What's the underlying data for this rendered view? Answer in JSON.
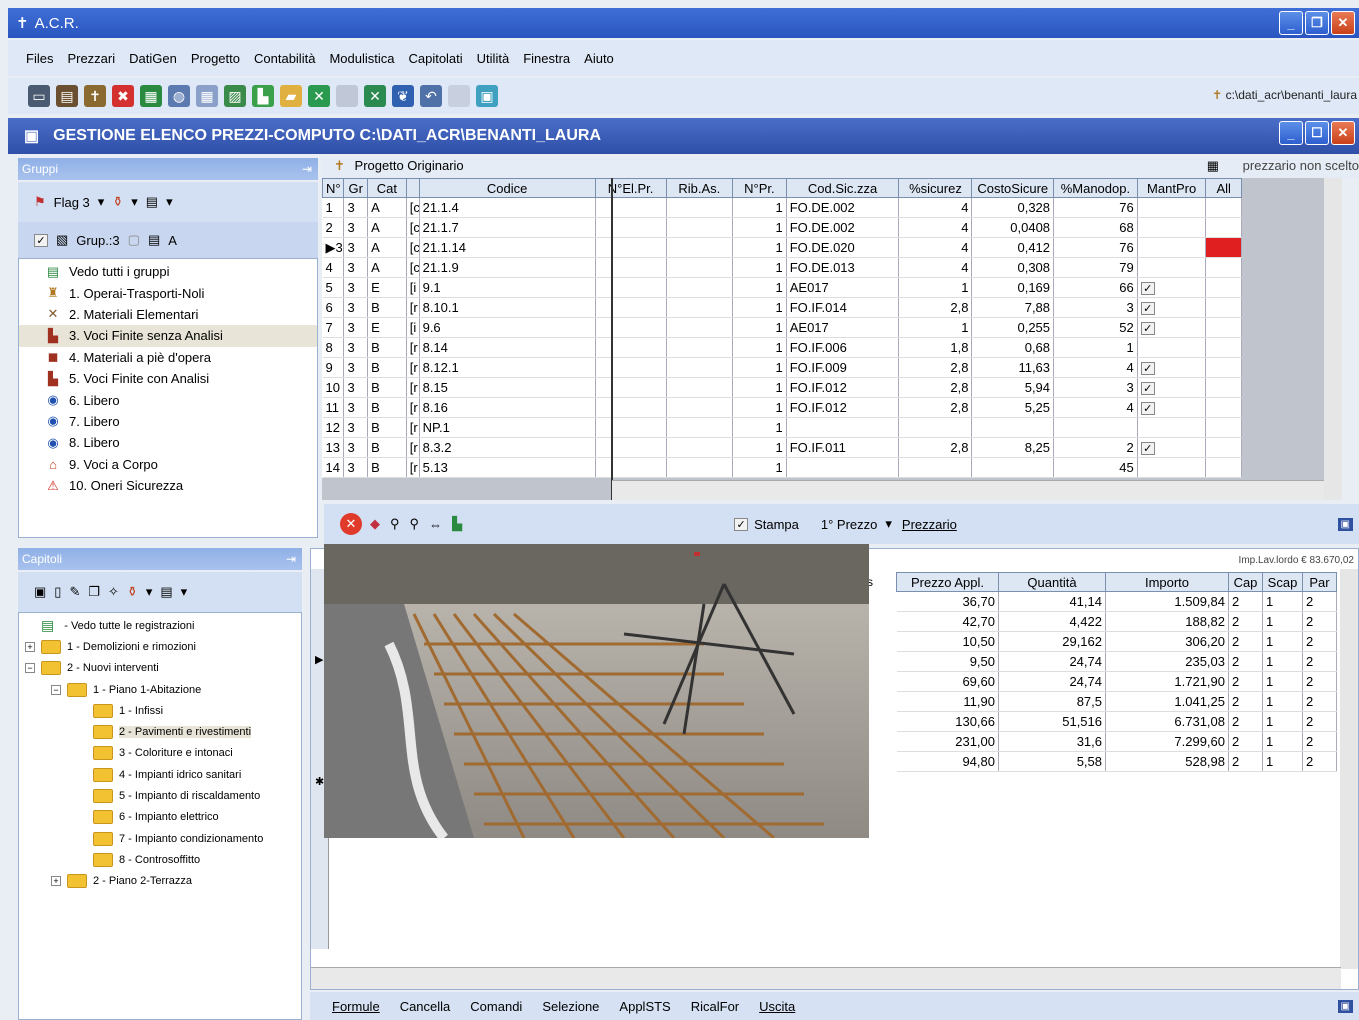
{
  "app": {
    "title": "A.C.R."
  },
  "menu": [
    "Files",
    "Prezzari",
    "DatiGen",
    "Progetto",
    "Contabilità",
    "Modulistica",
    "Capitolati",
    "Utilità",
    "Finestra",
    "Aiuto"
  ],
  "toolbar": {
    "path": "c:\\dati_acr\\benanti_laura"
  },
  "window": {
    "title": "GESTIONE ELENCO PREZZI-COMPUTO C:\\DATI_ACR\\BENANTI_LAURA"
  },
  "groups_panel": {
    "header": "Gruppi",
    "flag": "Flag 3",
    "grup": "Grup.:3",
    "a_label": "A",
    "items": [
      {
        "label": "Vedo tutti i gruppi",
        "icon": "book-icon"
      },
      {
        "label": "1. Operai-Trasporti-Noli",
        "icon": "worker-icon"
      },
      {
        "label": "2. Materiali Elementari",
        "icon": "tools-icon"
      },
      {
        "label": "3. Voci Finite senza Analisi",
        "icon": "building-icon"
      },
      {
        "label": "4. Materiali a piè d'opera",
        "icon": "truck-icon"
      },
      {
        "label": "5. Voci Finite con Analisi",
        "icon": "building-icon"
      },
      {
        "label": "6. Libero",
        "icon": "ring-icon"
      },
      {
        "label": "7. Libero",
        "icon": "ring-icon"
      },
      {
        "label": "8. Libero",
        "icon": "ring-icon"
      },
      {
        "label": "9. Voci a Corpo",
        "icon": "house-icon"
      },
      {
        "label": "10. Oneri Sicurezza",
        "icon": "warning-icon"
      }
    ]
  },
  "chapters_panel": {
    "header": "Capitoli",
    "items": [
      {
        "label": "- Vedo tutte le registrazioni",
        "indent": 0,
        "type": "book"
      },
      {
        "label": "1 - Demolizioni e rimozioni",
        "indent": 0,
        "type": "plus"
      },
      {
        "label": "2 - Nuovi interventi",
        "indent": 0,
        "type": "minus"
      },
      {
        "label": "1 - Piano 1-Abitazione",
        "indent": 1,
        "type": "minus"
      },
      {
        "label": "1 - Infissi",
        "indent": 2,
        "type": "folder"
      },
      {
        "label": "2 - Pavimenti e rivestimenti",
        "indent": 2,
        "type": "folder"
      },
      {
        "label": "3 - Coloriture e intonaci",
        "indent": 2,
        "type": "folder"
      },
      {
        "label": "4 - Impianti idrico sanitari",
        "indent": 2,
        "type": "folder"
      },
      {
        "label": "5 - Impianto di riscaldamento",
        "indent": 2,
        "type": "folder"
      },
      {
        "label": "6 - Impianto elettrico",
        "indent": 2,
        "type": "folder"
      },
      {
        "label": "7 - Impianto condizionamento",
        "indent": 2,
        "type": "folder"
      },
      {
        "label": "8 - Controsoffitto",
        "indent": 2,
        "type": "folder"
      },
      {
        "label": "2 - Piano 2-Terrazza",
        "indent": 1,
        "type": "plus"
      }
    ]
  },
  "price_grid": {
    "caption": "Progetto Originario",
    "right_caption": "prezzario non scelto",
    "headers": [
      "N°",
      "Gr",
      "Cat",
      "Codice",
      "N°El.Pr.",
      "Rib.As.",
      "N°Pr.",
      "Cod.Sic.zza",
      "%sicurez",
      "CostoSicure",
      "%Manodop.",
      "MantPro",
      "All"
    ],
    "rows": [
      [
        "1",
        "3",
        "A",
        "[c",
        "21.1.4",
        "",
        "",
        "1",
        "FO.DE.002",
        "4",
        "0,328",
        "76",
        "",
        ""
      ],
      [
        "2",
        "3",
        "A",
        "[c",
        "21.1.7",
        "",
        "",
        "1",
        "FO.DE.002",
        "4",
        "0,0408",
        "68",
        "",
        ""
      ],
      [
        "3",
        "3",
        "A",
        "[c",
        "21.1.14",
        "",
        "",
        "1",
        "FO.DE.020",
        "4",
        "0,412",
        "76",
        "",
        "red"
      ],
      [
        "4",
        "3",
        "A",
        "[c",
        "21.1.9",
        "",
        "",
        "1",
        "FO.DE.013",
        "4",
        "0,308",
        "79",
        "",
        ""
      ],
      [
        "5",
        "3",
        "E",
        "[i",
        "9.1",
        "",
        "",
        "1",
        "AE017",
        "1",
        "0,169",
        "66",
        "✓",
        ""
      ],
      [
        "6",
        "3",
        "B",
        "[r",
        "8.10.1",
        "",
        "",
        "1",
        "FO.IF.014",
        "2,8",
        "7,88",
        "3",
        "✓",
        ""
      ],
      [
        "7",
        "3",
        "E",
        "[i",
        "9.6",
        "",
        "",
        "1",
        "AE017",
        "1",
        "0,255",
        "52",
        "✓",
        ""
      ],
      [
        "8",
        "3",
        "B",
        "[r",
        "8.14",
        "",
        "",
        "1",
        "FO.IF.006",
        "1,8",
        "0,68",
        "1",
        "",
        ""
      ],
      [
        "9",
        "3",
        "B",
        "[r",
        "8.12.1",
        "",
        "",
        "1",
        "FO.IF.009",
        "2,8",
        "11,63",
        "4",
        "✓",
        ""
      ],
      [
        "10",
        "3",
        "B",
        "[r",
        "8.15",
        "",
        "",
        "1",
        "FO.IF.012",
        "2,8",
        "5,94",
        "3",
        "✓",
        ""
      ],
      [
        "11",
        "3",
        "B",
        "[r",
        "8.16",
        "",
        "",
        "1",
        "FO.IF.012",
        "2,8",
        "5,25",
        "4",
        "✓",
        ""
      ],
      [
        "12",
        "3",
        "B",
        "[r",
        "NP.1",
        "",
        "",
        "1",
        "",
        "",
        "",
        "",
        "",
        ""
      ],
      [
        "13",
        "3",
        "B",
        "[r",
        "8.3.2",
        "",
        "",
        "1",
        "FO.IF.011",
        "2,8",
        "8,25",
        "2",
        "✓",
        ""
      ],
      [
        "14",
        "3",
        "B",
        "[r",
        "5.13",
        "",
        "",
        "1",
        "",
        "",
        "",
        "45",
        "",
        ""
      ]
    ]
  },
  "photo_toolbar": {
    "stampa": "Stampa",
    "prezzo": "1° Prezzo",
    "prezzario": "Prezzario"
  },
  "computo_grid": {
    "caption": "Imp.Lav.lordo € 83.670,02",
    "cut_header": "tis",
    "headers": [
      "Prezzo Appl.",
      "Quantità",
      "Importo",
      "Cap",
      "Scap",
      "Par"
    ],
    "rows": [
      [
        "36,70",
        "41,14",
        "1.509,84",
        "2",
        "1",
        "2"
      ],
      [
        "42,70",
        "4,422",
        "188,82",
        "2",
        "1",
        "2"
      ],
      [
        "10,50",
        "29,162",
        "306,20",
        "2",
        "1",
        "2"
      ],
      [
        "9,50",
        "24,74",
        "235,03",
        "2",
        "1",
        "2"
      ],
      [
        "69,60",
        "24,74",
        "1.721,90",
        "2",
        "1",
        "2"
      ],
      [
        "11,90",
        "87,5",
        "1.041,25",
        "2",
        "1",
        "2"
      ],
      [
        "130,66",
        "51,516",
        "6.731,08",
        "2",
        "1",
        "2"
      ],
      [
        "231,00",
        "31,6",
        "7.299,60",
        "2",
        "1",
        "2"
      ],
      [
        "94,80",
        "5,58",
        "528,98",
        "2",
        "1",
        "2"
      ]
    ]
  },
  "bottom_menu": [
    "Formule",
    "Cancella",
    "Comandi",
    "Selezione",
    "ApplSTS",
    "RicalFor",
    "Uscita"
  ]
}
